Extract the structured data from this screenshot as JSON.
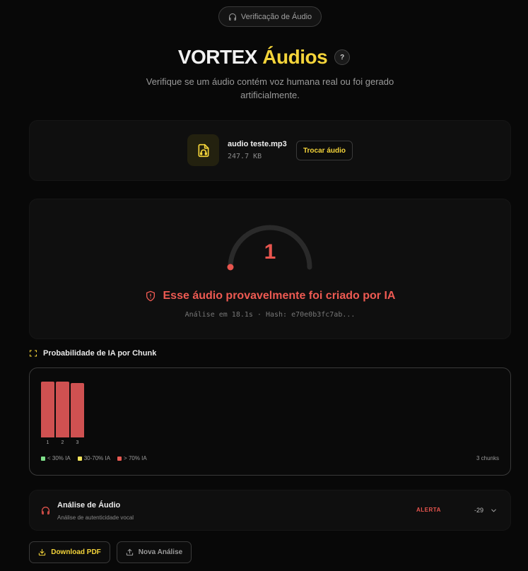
{
  "header": {
    "pill_label": "Verificação de Áudio",
    "title_brand": "VORTEX",
    "title_accent": "Áudios",
    "help_label": "?",
    "subtitle": "Verifique se um áudio contém voz humana real ou foi gerado artificialmente."
  },
  "file": {
    "name": "audio teste.mp3",
    "size": "247.7 KB",
    "swap_label": "Trocar áudio",
    "icon": "audio-file-icon"
  },
  "result": {
    "score": "1",
    "gauge_level": 0.0,
    "verdict": "Esse áudio provavelmente foi criado por IA",
    "meta": "Análise em 18.1s · Hash: e70e0b3fc7ab..."
  },
  "chunks": {
    "heading": "Probabilidade de IA por Chunk",
    "count_label": "3 chunks",
    "legend": [
      {
        "label": "< 30% IA",
        "color": "#7fe08a"
      },
      {
        "label": "30-70% IA",
        "color": "#f2e35c"
      },
      {
        "label": "> 70% IA",
        "color": "#e85a52"
      }
    ]
  },
  "chart_data": {
    "type": "bar",
    "categories": [
      "1",
      "2",
      "3"
    ],
    "values": [
      1.0,
      1.0,
      0.98
    ],
    "ylim": [
      0,
      1
    ],
    "bar_color": "#cf5151"
  },
  "analysis": {
    "title": "Análise de Áudio",
    "subtitle": "Análise de autenticidade vocal",
    "status": "ALERTA",
    "score": "-29"
  },
  "actions": {
    "download_label": "Download PDF",
    "new_label": "Nova Análise"
  },
  "colors": {
    "accent": "#f4d43a",
    "danger": "#e8554e",
    "background": "#080808"
  }
}
